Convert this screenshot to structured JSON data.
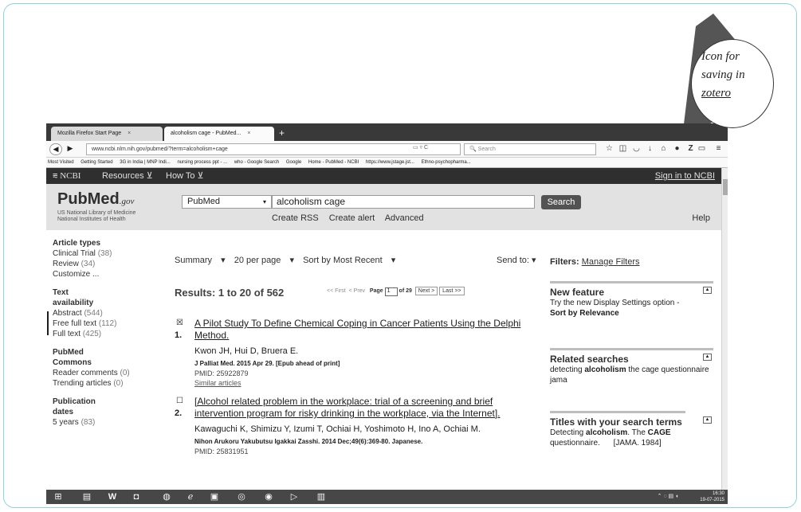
{
  "browser": {
    "tabs": [
      {
        "label": "Mozilla Firefox Start Page",
        "active": false
      },
      {
        "label": "alcoholism cage - PubMed...",
        "active": true
      }
    ],
    "new_tab": "+",
    "url_host": "www.ncbi.nlm.nih.gov",
    "url_path": "/pubmed/?term=alcoholism+cage",
    "search_placeholder": "Search",
    "bookmarks": [
      "Most Visited",
      "Getting Started",
      "3G in India | MNP Indi...",
      "nursing process ppt - ...",
      "who - Google Search",
      "Google",
      "Home - PubMed - NCBI",
      "https://www.jstage.jst...",
      "Ethno-psychopharma..."
    ]
  },
  "ncbi": {
    "logo": "NCBI",
    "resources": "Resources",
    "howto": "How To",
    "signin": "Sign in to NCBI"
  },
  "search": {
    "logo": "PubMed",
    "logo_suffix": ".gov",
    "sub1": "US National Library of Medicine",
    "sub2": "National Institutes of Health",
    "db": "PubMed",
    "query": "alcoholism cage",
    "button": "Search",
    "create_rss": "Create RSS",
    "create_alert": "Create alert",
    "advanced": "Advanced",
    "help": "Help"
  },
  "sidebar": {
    "g1": {
      "title": "Article types",
      "items": [
        {
          "label": "Clinical Trial",
          "count": "(38)"
        },
        {
          "label": "Review",
          "count": "(34)"
        },
        {
          "label": "Customize ...",
          "count": ""
        }
      ]
    },
    "g2": {
      "title": "Text availability",
      "items": [
        {
          "label": "Abstract",
          "count": "(544)"
        },
        {
          "label": "Free full text",
          "count": "(112)"
        },
        {
          "label": "Full text",
          "count": "(425)"
        }
      ]
    },
    "g3": {
      "title": "PubMed Commons",
      "items": [
        {
          "label": "Reader comments",
          "count": "(0)"
        },
        {
          "label": "Trending articles",
          "count": "(0)"
        }
      ]
    },
    "g4": {
      "title": "Publication dates",
      "items": [
        {
          "label": "5 years",
          "count": "(83)"
        }
      ]
    }
  },
  "toolbar": {
    "summary": "Summary",
    "per_page": "20 per page",
    "sort": "Sort by Most Recent",
    "send_to": "Send to:"
  },
  "results": {
    "heading": "Results: 1 to 20 of 562",
    "first": "<< First",
    "prev": "< Prev",
    "page_label": "Page",
    "page": "1",
    "of": "of 29",
    "next": "Next >",
    "last": "Last >>"
  },
  "items": [
    {
      "num": "1.",
      "checked": "☒",
      "title": "A Pilot Study To Define Chemical Coping in Cancer Patients Using the Delphi Method.",
      "authors": "Kwon JH, Hui D, Bruera E.",
      "journal": "J Palliat Med. 2015 Apr 29. [Epub ahead of print]",
      "pmid": "PMID: 25922879",
      "similar": "Similar articles"
    },
    {
      "num": "2.",
      "checked": "☐",
      "title": "[Alcohol related problem in the workplace: trial of a screening and brief intervention program for risky drinking in the workplace, via the Internet].",
      "authors": "Kawaguchi K, Shimizu Y, Izumi T, Ochiai H, Yoshimoto H, Ino A, Ochiai M.",
      "journal": "Nihon Arukoru Yakubutsu Igakkai Zasshi. 2014 Dec;49(6):369-80. Japanese.",
      "pmid": "PMID: 25831951"
    }
  ],
  "right": {
    "filters": "Filters:",
    "manage": "Manage Filters",
    "new_feature": {
      "title": "New feature",
      "text": "Try the new Display Settings option -",
      "bold": "Sort by Relevance"
    },
    "related": {
      "title": "Related searches",
      "text_a": "detecting ",
      "text_b": "alcoholism",
      "text_c": " the cage questionnaire jama"
    },
    "titles": {
      "title": "Titles with your search terms",
      "text_a": "Detecting ",
      "text_b": "alcoholism",
      "text_c": ". The ",
      "text_d": "CAGE",
      "text_e": " questionnaire.",
      "text_f": "[JAMA. 1984]"
    }
  },
  "taskbar": {
    "time": "16:30",
    "date": "19-07-2015"
  },
  "callout": {
    "line1": "Icon for",
    "line2": "saving in",
    "line3": "zotero"
  }
}
